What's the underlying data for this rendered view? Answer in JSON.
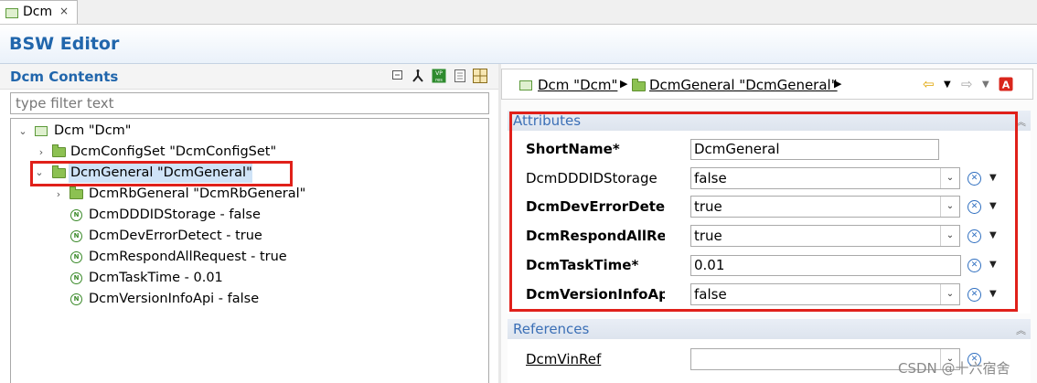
{
  "tab": {
    "label": "Dcm",
    "close_glyph": "×"
  },
  "header": {
    "title": "BSW Editor"
  },
  "left_panel": {
    "title": "Dcm Contents",
    "toolbar_icons": [
      "collapse-all-icon",
      "hierarchy-icon",
      "vp-res-icon",
      "document-icon",
      "layout-icon"
    ],
    "filter_placeholder": "type filter text",
    "tree": [
      {
        "label": "Dcm \"Dcm\"",
        "kind": "module",
        "expanded": true
      },
      {
        "label": "DcmConfigSet \"DcmConfigSet\"",
        "kind": "folder",
        "expanded": false
      },
      {
        "label": "DcmGeneral \"DcmGeneral\"",
        "kind": "folder",
        "expanded": true,
        "selected": true
      },
      {
        "label": "DcmRbGeneral \"DcmRbGeneral\"",
        "kind": "folder",
        "expanded": false
      },
      {
        "label": "DcmDDDIDStorage - false",
        "kind": "parameter"
      },
      {
        "label": "DcmDevErrorDetect - true",
        "kind": "parameter"
      },
      {
        "label": "DcmRespondAllRequest - true",
        "kind": "parameter"
      },
      {
        "label": "DcmTaskTime - 0.01",
        "kind": "parameter"
      },
      {
        "label": "DcmVersionInfoApi - false",
        "kind": "parameter"
      }
    ]
  },
  "breadcrumb": {
    "items": [
      "Dcm \"Dcm\"",
      "DcmGeneral \"DcmGeneral\""
    ],
    "nav_icons": [
      "back-arrow-icon",
      "forward-arrow-icon",
      "autosar-icon"
    ]
  },
  "attributes": {
    "title": "Attributes",
    "rows": [
      {
        "label": "ShortName*",
        "value": "DcmGeneral",
        "bold": true,
        "type": "text"
      },
      {
        "label": "DcmDDDIDStorage",
        "value": "false",
        "bold": false,
        "type": "combo"
      },
      {
        "label": "DcmDevErrorDetect",
        "value": "true",
        "bold": true,
        "type": "combo"
      },
      {
        "label": "DcmRespondAllRequ",
        "value": "true",
        "bold": true,
        "type": "combo"
      },
      {
        "label": "DcmTaskTime*",
        "value": "0.01",
        "bold": true,
        "type": "text"
      },
      {
        "label": "DcmVersionInfoApi*",
        "value": "false",
        "bold": true,
        "type": "combo"
      }
    ]
  },
  "references": {
    "title": "References",
    "rows": [
      {
        "label": "DcmVinRef",
        "value": ""
      }
    ]
  },
  "watermark": "CSDN @十六宿舍",
  "colors": {
    "accent": "#2166ac",
    "highlight": "#e0201a",
    "selection": "#cfe3f7"
  }
}
